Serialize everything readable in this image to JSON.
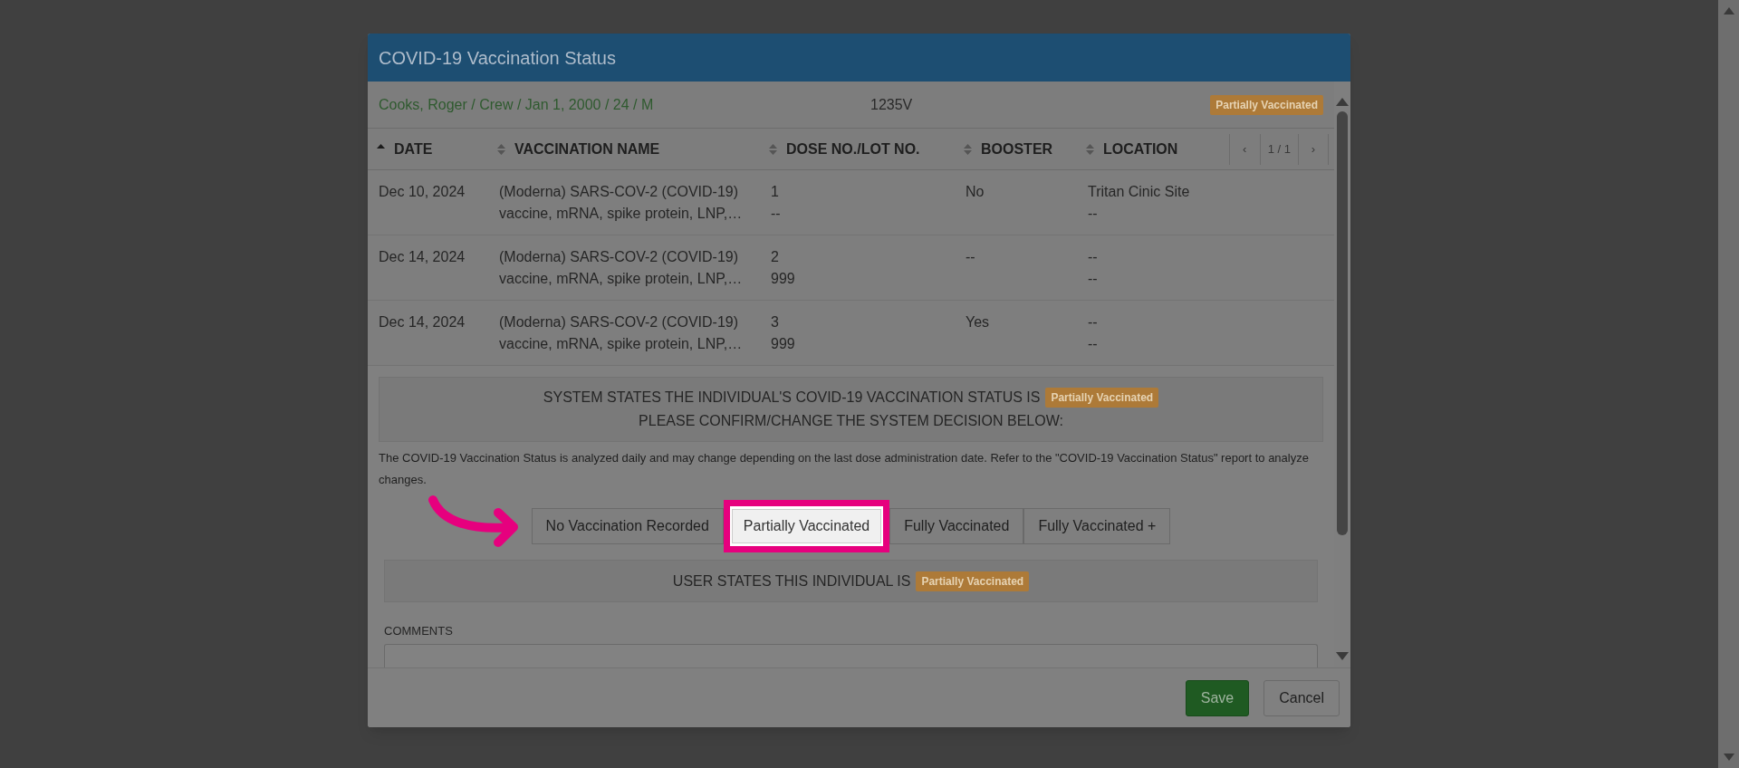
{
  "dialog": {
    "title": "COVID-19 Vaccination Status",
    "patient": "Cooks, Roger / Crew / Jan 1, 2000 / 24 / M",
    "record_id": "1235V",
    "status_badge": "Partially Vaccinated"
  },
  "table": {
    "columns": [
      {
        "label": "DATE",
        "sorted": true
      },
      {
        "label": "VACCINATION NAME",
        "sorted": false
      },
      {
        "label": "DOSE NO./LOT NO.",
        "sorted": false
      },
      {
        "label": "BOOSTER",
        "sorted": false
      },
      {
        "label": "LOCATION",
        "sorted": false
      }
    ],
    "pager": {
      "prev": "‹",
      "page": "1 / 1",
      "next": "›"
    },
    "rows": [
      {
        "date": "Dec 10, 2024",
        "name_line_1": "(Moderna) SARS-COV-2 (COVID-19)",
        "name_line_2": "vaccine, mRNA, spike protein, LNP,…",
        "dose": "1",
        "lot": "--",
        "booster": "No",
        "location_line_1": "Tritan Cinic Site",
        "location_line_2": "--"
      },
      {
        "date": "Dec 14, 2024",
        "name_line_1": "(Moderna) SARS-COV-2 (COVID-19)",
        "name_line_2": "vaccine, mRNA, spike protein, LNP,…",
        "dose": "2",
        "lot": "999",
        "booster": "--",
        "location_line_1": "--",
        "location_line_2": "--"
      },
      {
        "date": "Dec 14, 2024",
        "name_line_1": "(Moderna) SARS-COV-2 (COVID-19)",
        "name_line_2": "vaccine, mRNA, spike protein, LNP,…",
        "dose": "3",
        "lot": "999",
        "booster": "Yes",
        "location_line_1": "--",
        "location_line_2": "--"
      }
    ]
  },
  "system_notice": {
    "text": "SYSTEM STATES THE INDIVIDUAL'S COVID-19 VACCINATION STATUS IS",
    "badge": "Partially Vaccinated",
    "prompt": "PLEASE CONFIRM/CHANGE THE SYSTEM DECISION BELOW:"
  },
  "note": "The COVID-19 Vaccination Status is analyzed daily and may change depending on the last dose administration date. Refer to the \"COVID-19 Vaccination Status\" report to analyze changes.",
  "status_options": [
    {
      "label": "No Vaccination Recorded",
      "selected": false
    },
    {
      "label": "Partially Vaccinated",
      "selected": true
    },
    {
      "label": "Fully Vaccinated",
      "selected": false
    },
    {
      "label": "Fully Vaccinated +",
      "selected": false
    }
  ],
  "user_statement": {
    "text": "USER STATES THIS INDIVIDUAL IS",
    "badge": "Partially Vaccinated"
  },
  "comments": {
    "label": "COMMENTS"
  },
  "buttons": [
    {
      "label": "Save",
      "kind": "primary"
    },
    {
      "label": "Cancel",
      "kind": "secondary"
    }
  ]
}
